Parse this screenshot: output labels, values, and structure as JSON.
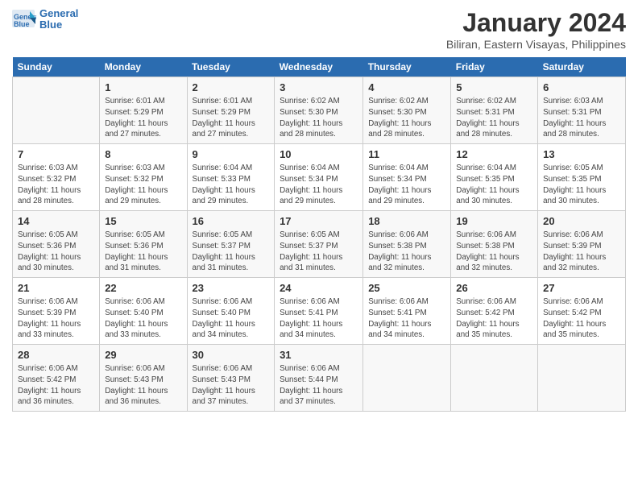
{
  "logo": {
    "line1": "General",
    "line2": "Blue"
  },
  "title": "January 2024",
  "subtitle": "Biliran, Eastern Visayas, Philippines",
  "days_header": [
    "Sunday",
    "Monday",
    "Tuesday",
    "Wednesday",
    "Thursday",
    "Friday",
    "Saturday"
  ],
  "weeks": [
    [
      {
        "num": "",
        "info": ""
      },
      {
        "num": "1",
        "info": "Sunrise: 6:01 AM\nSunset: 5:29 PM\nDaylight: 11 hours\nand 27 minutes."
      },
      {
        "num": "2",
        "info": "Sunrise: 6:01 AM\nSunset: 5:29 PM\nDaylight: 11 hours\nand 27 minutes."
      },
      {
        "num": "3",
        "info": "Sunrise: 6:02 AM\nSunset: 5:30 PM\nDaylight: 11 hours\nand 28 minutes."
      },
      {
        "num": "4",
        "info": "Sunrise: 6:02 AM\nSunset: 5:30 PM\nDaylight: 11 hours\nand 28 minutes."
      },
      {
        "num": "5",
        "info": "Sunrise: 6:02 AM\nSunset: 5:31 PM\nDaylight: 11 hours\nand 28 minutes."
      },
      {
        "num": "6",
        "info": "Sunrise: 6:03 AM\nSunset: 5:31 PM\nDaylight: 11 hours\nand 28 minutes."
      }
    ],
    [
      {
        "num": "7",
        "info": "Sunrise: 6:03 AM\nSunset: 5:32 PM\nDaylight: 11 hours\nand 28 minutes."
      },
      {
        "num": "8",
        "info": "Sunrise: 6:03 AM\nSunset: 5:32 PM\nDaylight: 11 hours\nand 29 minutes."
      },
      {
        "num": "9",
        "info": "Sunrise: 6:04 AM\nSunset: 5:33 PM\nDaylight: 11 hours\nand 29 minutes."
      },
      {
        "num": "10",
        "info": "Sunrise: 6:04 AM\nSunset: 5:34 PM\nDaylight: 11 hours\nand 29 minutes."
      },
      {
        "num": "11",
        "info": "Sunrise: 6:04 AM\nSunset: 5:34 PM\nDaylight: 11 hours\nand 29 minutes."
      },
      {
        "num": "12",
        "info": "Sunrise: 6:04 AM\nSunset: 5:35 PM\nDaylight: 11 hours\nand 30 minutes."
      },
      {
        "num": "13",
        "info": "Sunrise: 6:05 AM\nSunset: 5:35 PM\nDaylight: 11 hours\nand 30 minutes."
      }
    ],
    [
      {
        "num": "14",
        "info": "Sunrise: 6:05 AM\nSunset: 5:36 PM\nDaylight: 11 hours\nand 30 minutes."
      },
      {
        "num": "15",
        "info": "Sunrise: 6:05 AM\nSunset: 5:36 PM\nDaylight: 11 hours\nand 31 minutes."
      },
      {
        "num": "16",
        "info": "Sunrise: 6:05 AM\nSunset: 5:37 PM\nDaylight: 11 hours\nand 31 minutes."
      },
      {
        "num": "17",
        "info": "Sunrise: 6:05 AM\nSunset: 5:37 PM\nDaylight: 11 hours\nand 31 minutes."
      },
      {
        "num": "18",
        "info": "Sunrise: 6:06 AM\nSunset: 5:38 PM\nDaylight: 11 hours\nand 32 minutes."
      },
      {
        "num": "19",
        "info": "Sunrise: 6:06 AM\nSunset: 5:38 PM\nDaylight: 11 hours\nand 32 minutes."
      },
      {
        "num": "20",
        "info": "Sunrise: 6:06 AM\nSunset: 5:39 PM\nDaylight: 11 hours\nand 32 minutes."
      }
    ],
    [
      {
        "num": "21",
        "info": "Sunrise: 6:06 AM\nSunset: 5:39 PM\nDaylight: 11 hours\nand 33 minutes."
      },
      {
        "num": "22",
        "info": "Sunrise: 6:06 AM\nSunset: 5:40 PM\nDaylight: 11 hours\nand 33 minutes."
      },
      {
        "num": "23",
        "info": "Sunrise: 6:06 AM\nSunset: 5:40 PM\nDaylight: 11 hours\nand 34 minutes."
      },
      {
        "num": "24",
        "info": "Sunrise: 6:06 AM\nSunset: 5:41 PM\nDaylight: 11 hours\nand 34 minutes."
      },
      {
        "num": "25",
        "info": "Sunrise: 6:06 AM\nSunset: 5:41 PM\nDaylight: 11 hours\nand 34 minutes."
      },
      {
        "num": "26",
        "info": "Sunrise: 6:06 AM\nSunset: 5:42 PM\nDaylight: 11 hours\nand 35 minutes."
      },
      {
        "num": "27",
        "info": "Sunrise: 6:06 AM\nSunset: 5:42 PM\nDaylight: 11 hours\nand 35 minutes."
      }
    ],
    [
      {
        "num": "28",
        "info": "Sunrise: 6:06 AM\nSunset: 5:42 PM\nDaylight: 11 hours\nand 36 minutes."
      },
      {
        "num": "29",
        "info": "Sunrise: 6:06 AM\nSunset: 5:43 PM\nDaylight: 11 hours\nand 36 minutes."
      },
      {
        "num": "30",
        "info": "Sunrise: 6:06 AM\nSunset: 5:43 PM\nDaylight: 11 hours\nand 37 minutes."
      },
      {
        "num": "31",
        "info": "Sunrise: 6:06 AM\nSunset: 5:44 PM\nDaylight: 11 hours\nand 37 minutes."
      },
      {
        "num": "",
        "info": ""
      },
      {
        "num": "",
        "info": ""
      },
      {
        "num": "",
        "info": ""
      }
    ]
  ]
}
